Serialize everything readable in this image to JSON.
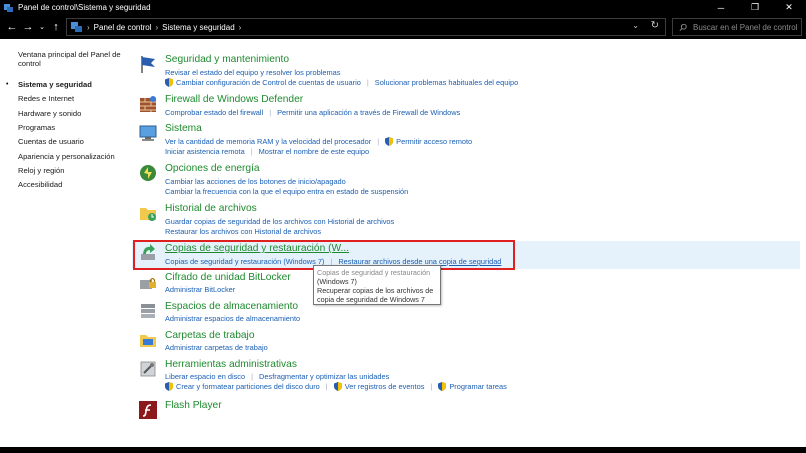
{
  "window": {
    "title": "Panel de control\\Sistema y seguridad",
    "minimize": "─",
    "maximize": "❐",
    "close": "✕"
  },
  "address": {
    "crumbs": [
      "Panel de control",
      "Sistema y seguridad"
    ],
    "separator": "›",
    "search_placeholder": "Buscar en el Panel de control"
  },
  "sidebar": {
    "items": [
      {
        "label": "Ventana principal del Panel de control",
        "current": false
      },
      {
        "label": "Sistema y seguridad",
        "current": true
      },
      {
        "label": "Redes e Internet",
        "current": false
      },
      {
        "label": "Hardware y sonido",
        "current": false
      },
      {
        "label": "Programas",
        "current": false
      },
      {
        "label": "Cuentas de usuario",
        "current": false
      },
      {
        "label": "Apariencia y personalización",
        "current": false
      },
      {
        "label": "Reloj y región",
        "current": false
      },
      {
        "label": "Accesibilidad",
        "current": false
      }
    ]
  },
  "categories": [
    {
      "title": "Seguridad y mantenimiento",
      "rows": [
        [
          {
            "text": "Revisar el estado del equipo y resolver los problemas",
            "shield": false
          }
        ],
        [
          {
            "text": "Cambiar configuración de Control de cuentas de usuario",
            "shield": true
          },
          {
            "text": "Solucionar problemas habituales del equipo",
            "shield": false
          }
        ]
      ]
    },
    {
      "title": "Firewall de Windows Defender",
      "rows": [
        [
          {
            "text": "Comprobar estado del firewall",
            "shield": false
          },
          {
            "text": "Permitir una aplicación a través de Firewall de Windows",
            "shield": false
          }
        ]
      ]
    },
    {
      "title": "Sistema",
      "rows": [
        [
          {
            "text": "Ver la cantidad de memoria RAM y la velocidad del procesador",
            "shield": false
          },
          {
            "text": "Permitir acceso remoto",
            "shield": true
          }
        ],
        [
          {
            "text": "Iniciar asistencia remota",
            "shield": false
          },
          {
            "text": "Mostrar el nombre de este equipo",
            "shield": false
          }
        ]
      ]
    },
    {
      "title": "Opciones de energía",
      "rows": [
        [
          {
            "text": "Cambiar las acciones de los botones de inicio/apagado",
            "shield": false
          }
        ],
        [
          {
            "text": "Cambiar la frecuencia con la que el equipo entra en estado de suspensión",
            "shield": false
          }
        ]
      ]
    },
    {
      "title": "Historial de archivos",
      "rows": [
        [
          {
            "text": "Guardar copias de seguridad de los archivos con Historial de archivos",
            "shield": false
          }
        ],
        [
          {
            "text": "Restaurar los archivos con Historial de archivos",
            "shield": false
          }
        ]
      ]
    },
    {
      "title": "Copias de seguridad y restauración (W...",
      "rows": [
        [
          {
            "text": "Copias de seguridad y restauración (Windows 7)",
            "shield": false
          },
          {
            "text": "Restaurar archivos desde una copia de seguridad",
            "shield": false
          }
        ]
      ]
    },
    {
      "title": "Cifrado de unidad BitLocker",
      "rows": [
        [
          {
            "text": "Administrar BitLocker",
            "shield": false
          }
        ]
      ]
    },
    {
      "title": "Espacios de almacenamiento",
      "rows": [
        [
          {
            "text": "Administrar espacios de almacenamiento",
            "shield": false
          }
        ]
      ]
    },
    {
      "title": "Carpetas de trabajo",
      "rows": [
        [
          {
            "text": "Administrar carpetas de trabajo",
            "shield": false
          }
        ]
      ]
    },
    {
      "title": "Herramientas administrativas",
      "rows": [
        [
          {
            "text": "Liberar espacio en disco",
            "shield": false
          },
          {
            "text": "Desfragmentar y optimizar las unidades",
            "shield": false
          }
        ],
        [
          {
            "text": "Crear y formatear particiones del disco duro",
            "shield": true
          },
          {
            "text": "Ver registros de eventos",
            "shield": true
          },
          {
            "text": "Programar tareas",
            "shield": true
          }
        ]
      ]
    },
    {
      "title": "Flash Player",
      "rows": []
    }
  ],
  "tooltip": {
    "line1": "Copias de seguridad y restauración",
    "line2": "(Windows 7)",
    "line3": "Recuperar copias de los archivos de",
    "line4": "copia de seguridad de Windows 7"
  },
  "colors": {
    "title_green": "#1e8a2e",
    "link_blue": "#1a5fb4",
    "highlight": "#e5f1fb",
    "red_box": "#e02020"
  }
}
